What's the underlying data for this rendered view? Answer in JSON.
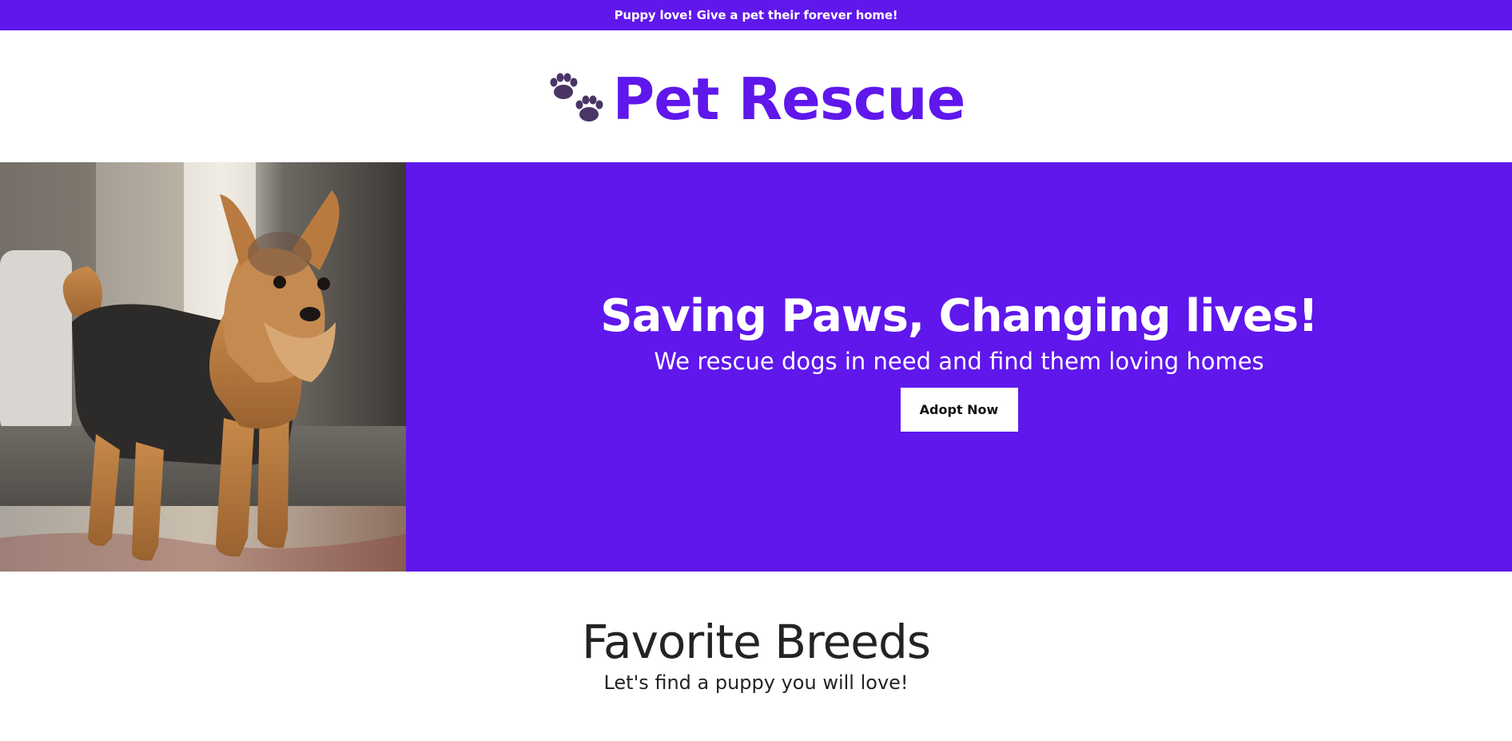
{
  "announcement": {
    "text": "Puppy love! Give a pet their forever home!"
  },
  "header": {
    "brand_name": "Pet Rescue",
    "logo_icon": "paw-prints-icon"
  },
  "hero": {
    "image": "yorkshire-terrier-photo",
    "title": "Saving Paws, Changing lives!",
    "subtitle": "We rescue dogs in need and find them loving homes",
    "cta_label": "Adopt Now"
  },
  "breeds": {
    "title": "Favorite Breeds",
    "subtitle": "Let's find a puppy you will love!"
  },
  "colors": {
    "brand": "#5f17ec",
    "paw": "#4a3566",
    "text_dark": "#232323"
  }
}
